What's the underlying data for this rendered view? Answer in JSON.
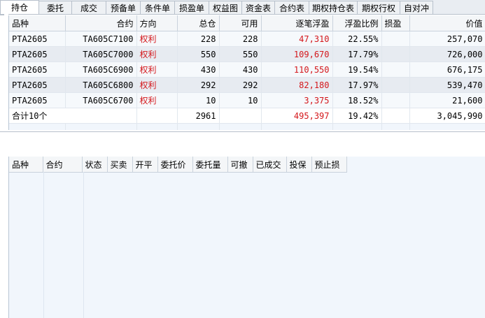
{
  "tabs": [
    {
      "label": "持仓",
      "active": true
    },
    {
      "label": "委托"
    },
    {
      "label": "成交"
    },
    {
      "label": "预备单"
    },
    {
      "label": "条件单"
    },
    {
      "label": "损盈单"
    },
    {
      "label": "权益图"
    },
    {
      "label": "资金表"
    },
    {
      "label": "合约表"
    },
    {
      "label": "期权持仓表"
    },
    {
      "label": "期权行权"
    },
    {
      "label": "自对冲"
    }
  ],
  "positions": {
    "headers": [
      "品种",
      "合约",
      "方向",
      "总仓",
      "可用",
      "逐笔浮盈",
      "浮盈比例",
      "损盈",
      "价值"
    ],
    "rows": [
      {
        "product": "PTA2605",
        "contract": "TA605C7100",
        "direction": "权利",
        "total": "228",
        "avail": "228",
        "pnl": "47,310",
        "ratio": "22.55%",
        "sl": "",
        "value": "257,070"
      },
      {
        "product": "PTA2605",
        "contract": "TA605C7000",
        "direction": "权利",
        "total": "550",
        "avail": "550",
        "pnl": "109,670",
        "ratio": "17.79%",
        "sl": "",
        "value": "726,000"
      },
      {
        "product": "PTA2605",
        "contract": "TA605C6900",
        "direction": "权利",
        "total": "430",
        "avail": "430",
        "pnl": "110,550",
        "ratio": "19.54%",
        "sl": "",
        "value": "676,175"
      },
      {
        "product": "PTA2605",
        "contract": "TA605C6800",
        "direction": "权利",
        "total": "292",
        "avail": "292",
        "pnl": "82,180",
        "ratio": "17.97%",
        "sl": "",
        "value": "539,470"
      },
      {
        "product": "PTA2605",
        "contract": "TA605C6700",
        "direction": "权利",
        "total": "10",
        "avail": "10",
        "pnl": "3,375",
        "ratio": "18.52%",
        "sl": "",
        "value": "21,600"
      }
    ],
    "total": {
      "label": "合计10个",
      "total": "2961",
      "pnl": "495,397",
      "ratio": "19.42%",
      "value": "3,045,990"
    }
  },
  "orders": {
    "headers": [
      "品种",
      "合约",
      "状态",
      "买卖",
      "开平",
      "委托价",
      "委托量",
      "可撤",
      "已成交",
      "投保",
      "预止损"
    ]
  },
  "colors": {
    "profit": "#d4171b",
    "row_alt": "#e7ebf1",
    "bg": "#f1f6fc"
  }
}
